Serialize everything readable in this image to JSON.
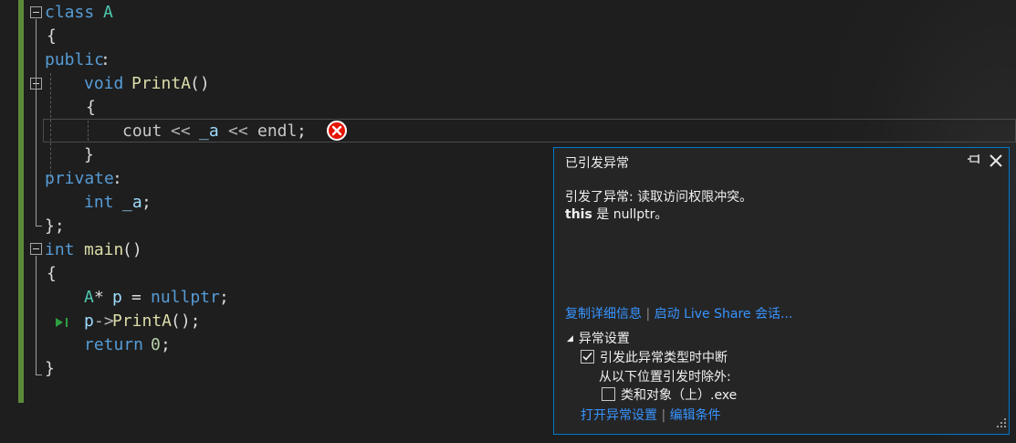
{
  "code": {
    "l1": {
      "kw": "class",
      "name": "A"
    },
    "l2": {
      "brace": "{"
    },
    "l3": {
      "kw": "public",
      "colon": ":"
    },
    "l4": {
      "kw": "void",
      "fn": "PrintA",
      "paren": "()"
    },
    "l5": {
      "brace": "{"
    },
    "l6": {
      "id1": "cout",
      "op1": "<<",
      "id2": "_a",
      "op2": "<<",
      "id3": "endl",
      "semi": ";"
    },
    "l7": {
      "brace": "}"
    },
    "l8": {
      "kw": "private",
      "colon": ":"
    },
    "l9": {
      "kw": "int",
      "var": "_a",
      "semi": ";"
    },
    "l10": {
      "brace": "};"
    },
    "l11": {
      "kw": "int",
      "fn": "main",
      "paren": "()"
    },
    "l12": {
      "brace": "{"
    },
    "l13": {
      "cls": "A",
      "star": "*",
      "var": "p",
      "eq": "=",
      "kw": "nullptr",
      "semi": ";"
    },
    "l14": {
      "var": "p",
      "arrow": "->",
      "fn": "PrintA",
      "paren": "();"
    },
    "l15": {
      "kw": "return",
      "num": "0",
      "semi": ";"
    },
    "l16": {
      "brace": "}"
    }
  },
  "exception_popup": {
    "title": "已引发异常",
    "message_line1": "引发了异常: 读取访问权限冲突。",
    "message_bold": "this",
    "message_line2_rest": " 是 nullptr。",
    "link_copy_details": "复制详细信息",
    "link_live_share": "启动 Live Share 会话...",
    "separator": "|",
    "section_title": "异常设置",
    "break_when_thrown": "引发此异常类型时中断",
    "break_when_thrown_checked": true,
    "except_when_from": "从以下位置引发时除外:",
    "module_option": "类和对象（上）.exe",
    "module_option_checked": false,
    "link_open_settings": "打开异常设置",
    "link_edit_conditions": "编辑条件"
  },
  "colors": {
    "accent": "#007acc",
    "error": "#e51400",
    "link": "#3794ff",
    "change_bar": "#5c8a3a"
  },
  "icons": {
    "error": "error-circle-x-icon",
    "pin": "pin-icon",
    "close": "close-icon",
    "next_statement": "next-statement-arrow-icon"
  }
}
